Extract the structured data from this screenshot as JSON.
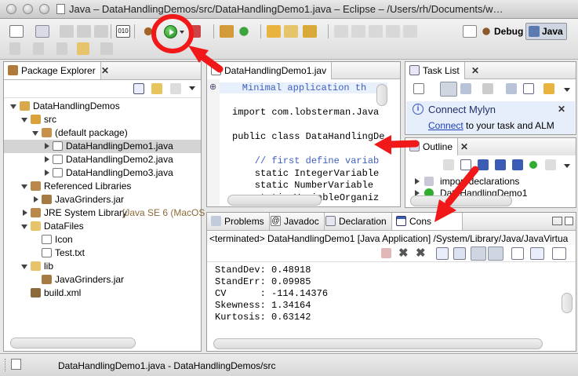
{
  "window": {
    "title": "Java – DataHandlingDemos/src/DataHandlingDemo1.java – Eclipse – /Users/rh/Documents/w…"
  },
  "perspectives": {
    "debug_label": "Debug",
    "java_label": "Java"
  },
  "package_explorer": {
    "tab_label": "Package Explorer",
    "tree": [
      {
        "label": "DataHandlingDemos",
        "depth": 0,
        "expanded": true,
        "icon": "project-icon"
      },
      {
        "label": "src",
        "depth": 1,
        "expanded": true,
        "icon": "source-folder-icon"
      },
      {
        "label": "(default package)",
        "depth": 2,
        "expanded": true,
        "icon": "package-icon"
      },
      {
        "label": "DataHandlingDemo1.java",
        "depth": 3,
        "expanded": false,
        "icon": "java-file-icon",
        "selected": true
      },
      {
        "label": "DataHandlingDemo2.java",
        "depth": 3,
        "expanded": false,
        "icon": "java-file-icon"
      },
      {
        "label": "DataHandlingDemo3.java",
        "depth": 3,
        "expanded": false,
        "icon": "java-file-icon"
      },
      {
        "label": "Referenced Libraries",
        "depth": 1,
        "expanded": true,
        "icon": "library-icon"
      },
      {
        "label": "JavaGrinders.jar",
        "depth": 2,
        "expanded": false,
        "icon": "jar-icon"
      },
      {
        "label": "JRE System Library",
        "suffix": " [Java SE 6 (MacOS",
        "depth": 1,
        "expanded": false,
        "icon": "library-icon"
      },
      {
        "label": "DataFiles",
        "depth": 1,
        "expanded": true,
        "icon": "folder-icon"
      },
      {
        "label": "Icon",
        "depth": 2,
        "expanded": null,
        "icon": "file-icon"
      },
      {
        "label": "Test.txt",
        "depth": 2,
        "expanded": null,
        "icon": "file-icon"
      },
      {
        "label": "lib",
        "depth": 1,
        "expanded": true,
        "icon": "folder-icon"
      },
      {
        "label": "JavaGrinders.jar",
        "depth": 2,
        "expanded": null,
        "icon": "jar-icon"
      },
      {
        "label": "build.xml",
        "depth": 1,
        "expanded": null,
        "icon": "ant-file-icon"
      }
    ]
  },
  "editor": {
    "tab_label": "DataHandlingDemo1.jav",
    "lines": [
      {
        "text": "Minimal application th",
        "kind": "comment-highlight"
      },
      {
        "text": "",
        "kind": "plain"
      },
      {
        "text": "import com.lobsterman.Java",
        "kind": "plain"
      },
      {
        "text": "",
        "kind": "plain"
      },
      {
        "text": "public class DataHandlingDe",
        "kind": "plain"
      },
      {
        "text": "",
        "kind": "plain"
      },
      {
        "text": "    // first define variab",
        "kind": "comment"
      },
      {
        "text": "    static IntegerVariable",
        "kind": "plain"
      },
      {
        "text": "    static NumberVariable ",
        "kind": "plain"
      },
      {
        "text": "    static VariableOrganiz",
        "kind": "plain"
      }
    ]
  },
  "task_list": {
    "tab_label": "Task List",
    "mylyn_title": "Connect Mylyn",
    "mylyn_link": "Connect",
    "mylyn_text": " to your task and ALM"
  },
  "outline": {
    "tab_label": "Outline",
    "items": [
      {
        "label": "import declarations"
      },
      {
        "label": "DataHandlingDemo1"
      }
    ]
  },
  "bottom_tabs": {
    "problems": "Problems",
    "javadoc": "Javadoc",
    "declaration": "Declaration",
    "console": "Cons"
  },
  "console": {
    "header": "<terminated> DataHandlingDemo1 [Java Application] /System/Library/Java/JavaVirtua",
    "output": [
      "StandDev: 0.48918",
      "StandErr: 0.09985",
      "CV      : -114.14376",
      "Skewness: 1.34164",
      "Kurtosis: 0.63142"
    ]
  },
  "status": {
    "text": "DataHandlingDemo1.java - DataHandlingDemos/src"
  },
  "colors": {
    "annotation_red": "#f01818",
    "selection": "#d4d4d4",
    "link_blue": "#1a3fb8",
    "comment_blue": "#3f5fbf",
    "mylyn_bg": "#e6eefb"
  }
}
